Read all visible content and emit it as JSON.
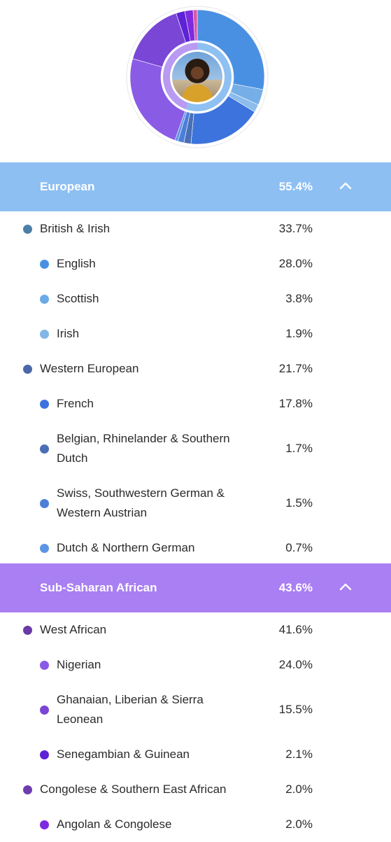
{
  "donut": {
    "slices": [
      {
        "value": 28.0,
        "color": "#4a90e2"
      },
      {
        "value": 3.8,
        "color": "#76aee8"
      },
      {
        "value": 1.9,
        "color": "#8cbdec"
      },
      {
        "value": 17.8,
        "color": "#3d73dc"
      },
      {
        "value": 1.7,
        "color": "#4a6fb6"
      },
      {
        "value": 1.5,
        "color": "#4d7fd8"
      },
      {
        "value": 0.7,
        "color": "#5d94e6"
      },
      {
        "value": 24.0,
        "color": "#8a5be4"
      },
      {
        "value": 15.5,
        "color": "#7a46d6"
      },
      {
        "value": 2.1,
        "color": "#5d21d6"
      },
      {
        "value": 2.0,
        "color": "#7d2ae0"
      },
      {
        "value": 1.0,
        "color": "#d65aa8"
      }
    ],
    "inner_ring_colors": [
      "#8fc0f2",
      "#b89af2"
    ]
  },
  "regions": [
    {
      "name": "European",
      "percent": "55.4%",
      "header_color": "#8dbff3",
      "expanded": true,
      "rows": [
        {
          "label": "British & Irish",
          "percent": "33.7%",
          "level": 1,
          "dot": "#4c7fa8"
        },
        {
          "label": "English",
          "percent": "28.0%",
          "level": 2,
          "dot": "#4a90e2"
        },
        {
          "label": "Scottish",
          "percent": "3.8%",
          "level": 2,
          "dot": "#6aaae6"
        },
        {
          "label": "Irish",
          "percent": "1.9%",
          "level": 2,
          "dot": "#82b6e6"
        },
        {
          "label": "Western European",
          "percent": "21.7%",
          "level": 1,
          "dot": "#4a68a8"
        },
        {
          "label": "French",
          "percent": "17.8%",
          "level": 2,
          "dot": "#3d73dc"
        },
        {
          "label": "Belgian, Rhinelander & Southern Dutch",
          "lines": [
            "Belgian, Rhinelander & Southern",
            "Dutch"
          ],
          "percent": "1.7%",
          "level": 2,
          "dot": "#4a6fb6"
        },
        {
          "label": "Swiss, Southwestern German & Western Austrian",
          "lines": [
            "Swiss, Southwestern German &",
            "Western Austrian"
          ],
          "percent": "1.5%",
          "level": 2,
          "dot": "#4d7fd8"
        },
        {
          "label": "Dutch & Northern German",
          "percent": "0.7%",
          "level": 2,
          "dot": "#5d94e6"
        }
      ]
    },
    {
      "name": "Sub-Saharan African",
      "percent": "43.6%",
      "header_color": "#a97ff3",
      "expanded": true,
      "rows": [
        {
          "label": "West African",
          "percent": "41.6%",
          "level": 1,
          "dot": "#6a3aa8"
        },
        {
          "label": "Nigerian",
          "percent": "24.0%",
          "level": 2,
          "dot": "#8a5be4"
        },
        {
          "label": "Ghanaian, Liberian & Sierra Leonean",
          "lines": [
            "Ghanaian, Liberian & Sierra",
            "Leonean"
          ],
          "percent": "15.5%",
          "level": 2,
          "dot": "#7a46d6"
        },
        {
          "label": "Senegambian & Guinean",
          "percent": "2.1%",
          "level": 2,
          "dot": "#5d21d6"
        },
        {
          "label": "Congolese & Southern East African",
          "percent": "2.0%",
          "level": 1,
          "dot": "#6d3cae"
        },
        {
          "label": "Angolan & Congolese",
          "percent": "2.0%",
          "level": 2,
          "dot": "#7d2ae0"
        }
      ]
    }
  ]
}
